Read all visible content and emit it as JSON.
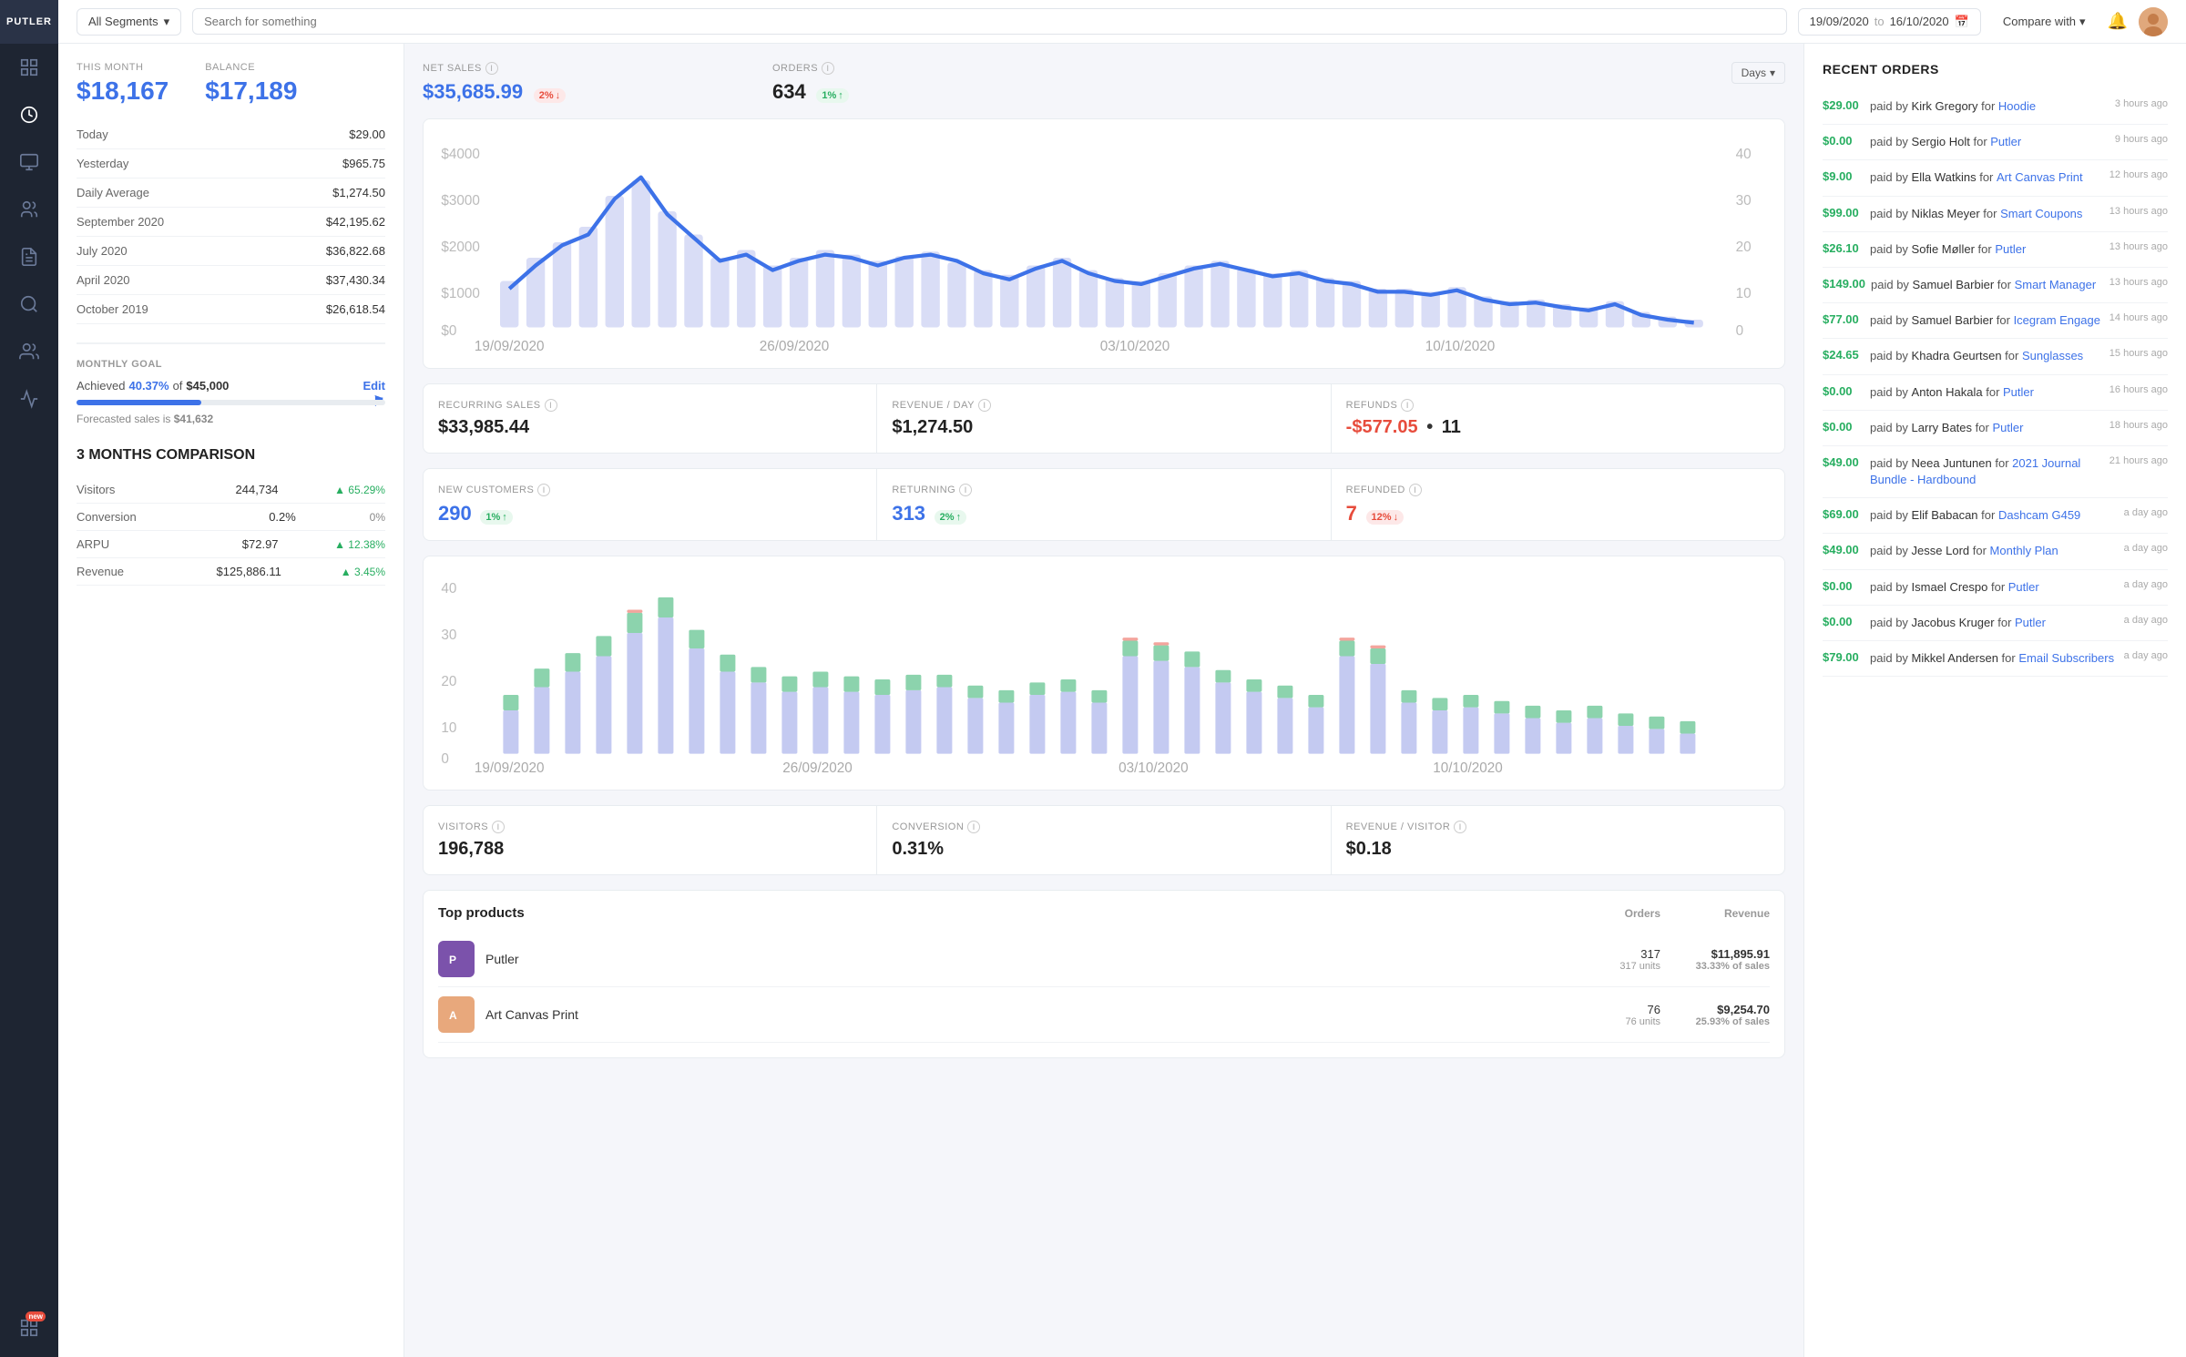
{
  "app": {
    "name": "PUTLER"
  },
  "header": {
    "segment_label": "All Segments",
    "search_placeholder": "Search for something",
    "date_from": "19/09/2020",
    "date_to": "16/10/2020",
    "compare_label": "Compare with"
  },
  "left_panel": {
    "this_month_label": "THIS MONTH",
    "balance_label": "BALANCE",
    "this_month_value": "$18,167",
    "balance_value": "$17,189",
    "rows": [
      {
        "label": "Today",
        "value": "$29.00"
      },
      {
        "label": "Yesterday",
        "value": "$965.75"
      },
      {
        "label": "Daily Average",
        "value": "$1,274.50"
      },
      {
        "label": "September 2020",
        "value": "$42,195.62"
      },
      {
        "label": "July 2020",
        "value": "$36,822.68"
      },
      {
        "label": "April 2020",
        "value": "$37,430.34"
      },
      {
        "label": "October 2019",
        "value": "$26,618.54"
      }
    ],
    "monthly_goal": {
      "title": "MONTHLY GOAL",
      "achieved_pct": "40.37%",
      "of": "of",
      "goal_amount": "$45,000",
      "edit_label": "Edit",
      "forecast_label": "Forecasted sales is",
      "forecast_value": "$41,632"
    },
    "comparison": {
      "title": "3 MONTHS COMPARISON",
      "rows": [
        {
          "label": "Visitors",
          "value": "244,734",
          "change": "65.29%",
          "dir": "up"
        },
        {
          "label": "Conversion",
          "value": "0.2%",
          "change": "0%",
          "dir": "neutral"
        },
        {
          "label": "ARPU",
          "value": "$72.97",
          "change": "12.38%",
          "dir": "up"
        },
        {
          "label": "Revenue",
          "value": "$125,886.11",
          "change": "3.45%",
          "dir": "up"
        }
      ]
    }
  },
  "center_panel": {
    "net_sales": {
      "label": "NET SALES",
      "value": "$35,685.99",
      "badge": "2%",
      "badge_dir": "down"
    },
    "orders": {
      "label": "ORDERS",
      "value": "634",
      "badge": "1%",
      "badge_dir": "up"
    },
    "days_btn": "Days",
    "chart_dates": [
      "19/09/2020",
      "26/09/2020",
      "03/10/2020",
      "10/10/2020"
    ],
    "chart_y_labels": [
      "$4000",
      "$3000",
      "$2000",
      "$1000",
      "$0"
    ],
    "chart_y_right": [
      "40",
      "30",
      "20",
      "10",
      "0"
    ],
    "recurring_sales": {
      "label": "RECURRING SALES",
      "value": "$33,985.44"
    },
    "revenue_day": {
      "label": "REVENUE / DAY",
      "value": "$1,274.50"
    },
    "refunds": {
      "label": "REFUNDS",
      "value": "-$577.05",
      "dot": "•",
      "count": "11"
    },
    "new_customers": {
      "label": "NEW CUSTOMERS",
      "value": "290",
      "badge": "1%",
      "badge_dir": "up"
    },
    "returning": {
      "label": "RETURNING",
      "value": "313",
      "badge": "2%",
      "badge_dir": "up"
    },
    "refunded": {
      "label": "REFUNDED",
      "value": "7",
      "badge": "12%",
      "badge_dir": "down"
    },
    "bar_chart_dates": [
      "19/09/2020",
      "26/09/2020",
      "03/10/2020",
      "10/10/2020"
    ],
    "bar_chart_y": [
      "40",
      "30",
      "20",
      "10",
      "0"
    ],
    "visitors": {
      "label": "VISITORS",
      "value": "196,788"
    },
    "conversion": {
      "label": "CONVERSION",
      "value": "0.31%"
    },
    "revenue_visitor": {
      "label": "REVENUE / VISITOR",
      "value": "$0.18"
    },
    "top_products": {
      "title": "Top products",
      "orders_col": "Orders",
      "revenue_col": "Revenue",
      "items": [
        {
          "name": "Putler",
          "color": "#7b52ab",
          "orders": "317",
          "units": "317 units",
          "revenue": "$11,895.91",
          "pct": "33.33% of sales"
        },
        {
          "name": "Art Canvas Print",
          "color": "#e8a87c",
          "orders": "76",
          "units": "76 units",
          "revenue": "$9,254.70",
          "pct": "25.93% of sales"
        }
      ]
    }
  },
  "right_panel": {
    "title": "RECENT ORDERS",
    "orders": [
      {
        "amount": "$29.00",
        "paid_by": "Kirk Gregory",
        "product": "Hoodie",
        "time": "3 hours ago"
      },
      {
        "amount": "$0.00",
        "paid_by": "Sergio Holt",
        "product": "Putler",
        "time": "9 hours ago"
      },
      {
        "amount": "$9.00",
        "paid_by": "Ella Watkins",
        "product": "Art Canvas Print",
        "time": "12 hours ago"
      },
      {
        "amount": "$99.00",
        "paid_by": "Niklas Meyer",
        "product": "Smart Coupons",
        "time": "13 hours ago"
      },
      {
        "amount": "$26.10",
        "paid_by": "Sofie Møller",
        "product": "Putler",
        "time": "13 hours ago"
      },
      {
        "amount": "$149.00",
        "paid_by": "Samuel Barbier",
        "product": "Smart Manager",
        "time": "13 hours ago"
      },
      {
        "amount": "$77.00",
        "paid_by": "Samuel Barbier",
        "product": "Icegram Engage",
        "time": "14 hours ago"
      },
      {
        "amount": "$24.65",
        "paid_by": "Khadra Geurtsen",
        "product": "Sunglasses",
        "time": "15 hours ago"
      },
      {
        "amount": "$0.00",
        "paid_by": "Anton Hakala",
        "product": "Putler",
        "time": "16 hours ago"
      },
      {
        "amount": "$0.00",
        "paid_by": "Larry Bates",
        "product": "Putler",
        "time": "18 hours ago"
      },
      {
        "amount": "$49.00",
        "paid_by": "Neea Juntunen",
        "product": "2021 Journal Bundle - Hardbound",
        "time": "21 hours ago"
      },
      {
        "amount": "$69.00",
        "paid_by": "Elif Babacan",
        "product": "Dashcam G459",
        "time": "a day ago"
      },
      {
        "amount": "$49.00",
        "paid_by": "Jesse Lord",
        "product": "Monthly Plan",
        "time": "a day ago"
      },
      {
        "amount": "$0.00",
        "paid_by": "Ismael Crespo",
        "product": "Putler",
        "time": "a day ago"
      },
      {
        "amount": "$0.00",
        "paid_by": "Jacobus Kruger",
        "product": "Putler",
        "time": "a day ago"
      },
      {
        "amount": "$79.00",
        "paid_by": "Mikkel Andersen",
        "product": "Email Subscribers",
        "time": "a day ago"
      }
    ]
  }
}
